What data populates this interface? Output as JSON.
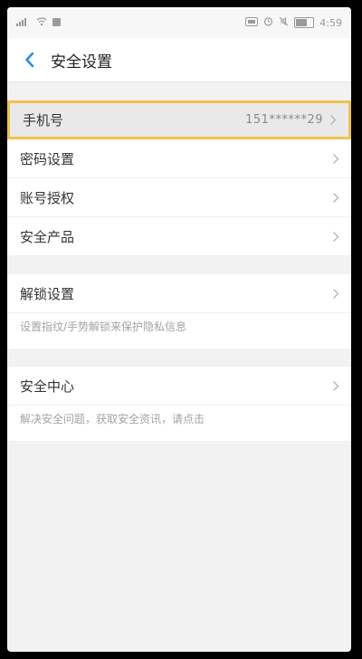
{
  "statusbar": {
    "time": "4:59",
    "left_icons": [
      "signal-icon",
      "wifi-icon",
      "notification-icon"
    ],
    "right_icons": [
      "hd-icon",
      "alarm-icon",
      "mute-icon",
      "battery-icon"
    ]
  },
  "header": {
    "title": "安全设置",
    "back_icon": "chevron-left-icon"
  },
  "colors": {
    "accent": "#1e88e5",
    "highlight_border": "#f2c14e"
  },
  "groups": [
    {
      "rows": [
        {
          "label": "手机号",
          "value": "151******29",
          "highlighted": true
        },
        {
          "label": "密码设置"
        },
        {
          "label": "账号授权"
        },
        {
          "label": "安全产品"
        }
      ]
    },
    {
      "rows": [
        {
          "label": "解锁设置"
        }
      ],
      "description": "设置指纹/手势解锁来保护隐私信息"
    },
    {
      "rows": [
        {
          "label": "安全中心"
        }
      ],
      "description": "解决安全问题，获取安全资讯，请点击"
    }
  ]
}
